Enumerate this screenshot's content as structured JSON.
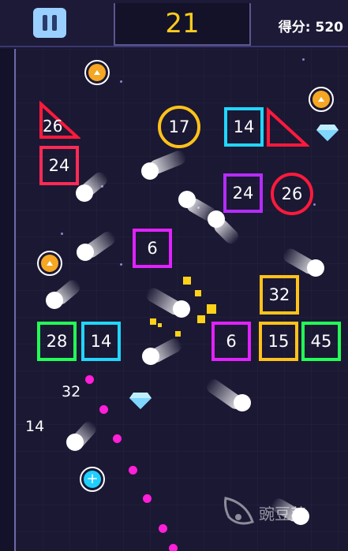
{
  "hud": {
    "level": "21",
    "score_label": "得分: 520"
  },
  "blocks": [
    {
      "value": "24",
      "color": "#ff2a55"
    },
    {
      "value": "14",
      "color": "#22d6ff"
    },
    {
      "value": "24",
      "color": "#b52cff"
    },
    {
      "value": "6",
      "color": "#e022ff"
    },
    {
      "value": "32",
      "color": "#ffc21a"
    },
    {
      "value": "28",
      "color": "#22ff55"
    },
    {
      "value": "14",
      "color": "#22d6ff"
    },
    {
      "value": "6",
      "color": "#e022ff"
    },
    {
      "value": "15",
      "color": "#ffc21a"
    },
    {
      "value": "45",
      "color": "#22ff55"
    }
  ],
  "circles": [
    {
      "value": "17",
      "color": "#ffc21a"
    },
    {
      "value": "26",
      "color": "#ff1a3c"
    }
  ],
  "triangles": [
    {
      "value": "26",
      "color": "#ff1a3c"
    }
  ],
  "floating_numbers": [
    "32",
    "14"
  ],
  "watermark_text": "豌豆荚"
}
